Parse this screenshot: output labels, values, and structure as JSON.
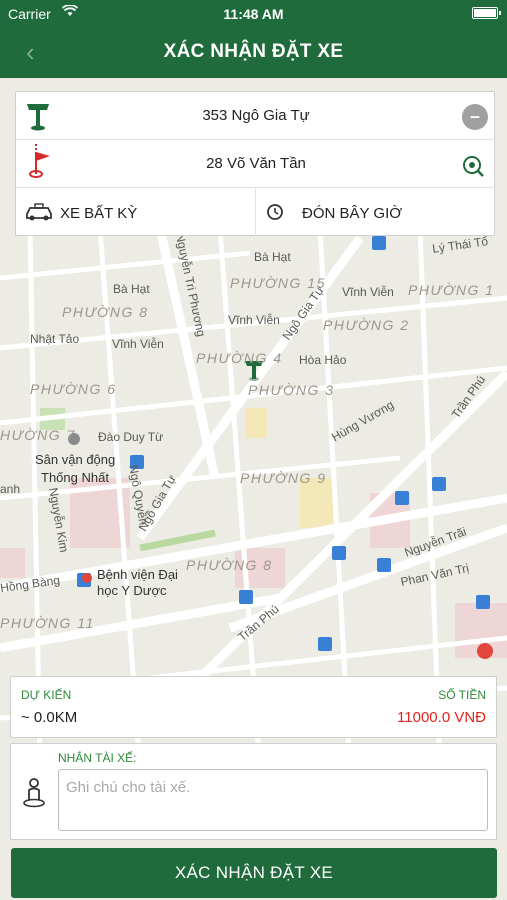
{
  "status_bar": {
    "carrier": "Carrier",
    "time": "11:48 AM"
  },
  "nav": {
    "title": "XÁC NHẬN ĐẶT XE",
    "back_icon": "chevron-left-icon"
  },
  "trip": {
    "pickup": "353 Ngô Gia Tự",
    "dropoff": "28 Võ Văn Tần",
    "vehicle_label": "XE BẤT KỲ",
    "time_label": "ĐÓN BÂY GIỜ"
  },
  "map": {
    "wards": [
      "PHƯỜNG 15",
      "PHƯỜNG 8",
      "PHƯỜNG 1",
      "PHƯỜNG 2",
      "PHƯỜNG 4",
      "PHƯỜNG 6",
      "PHƯỜNG 3",
      "HƯỜNG 7",
      "PHƯỜNG 9",
      "PHƯỜNG 8",
      "PHƯỜNG 11"
    ],
    "streets": [
      "Bà Hạt",
      "Bà Hạt",
      "Lý Thái Tổ",
      "Vĩnh Viễn",
      "Vĩnh Viễn",
      "Vĩnh Viễn",
      "Nhật Tảo",
      "Hòa Hảo",
      "Đào Duy Từ",
      "Hùng Vương",
      "Trần Phú",
      "Ngô Quyền",
      "Nguyễn Kim",
      "Nguyễn Trãi",
      "Phan Văn Trị",
      "Trần Phú",
      "Hồng Bàng",
      "anh",
      "Nguyễn Tri Phương",
      "Ngô Gia Tự",
      "Ngô Gia Tự"
    ],
    "places": [
      "Sân vận động",
      "Thống Nhất",
      "Bệnh viện Đại",
      "học Y Dược"
    ]
  },
  "estimate": {
    "distance_label": "DỰ KIẾN",
    "distance_value": "~ 0.0KM",
    "price_label": "SỐ TIỀN",
    "price_value": "11000.0 VNĐ"
  },
  "note": {
    "label": "NHẮN TÀI XẾ:",
    "placeholder": "Ghi chú cho tài xế."
  },
  "confirm_label": "XÁC NHẬN ĐẶT XE",
  "colors": {
    "primary": "#1f6b3c",
    "accent_text": "#2e8b3b",
    "price": "#e2241b"
  }
}
